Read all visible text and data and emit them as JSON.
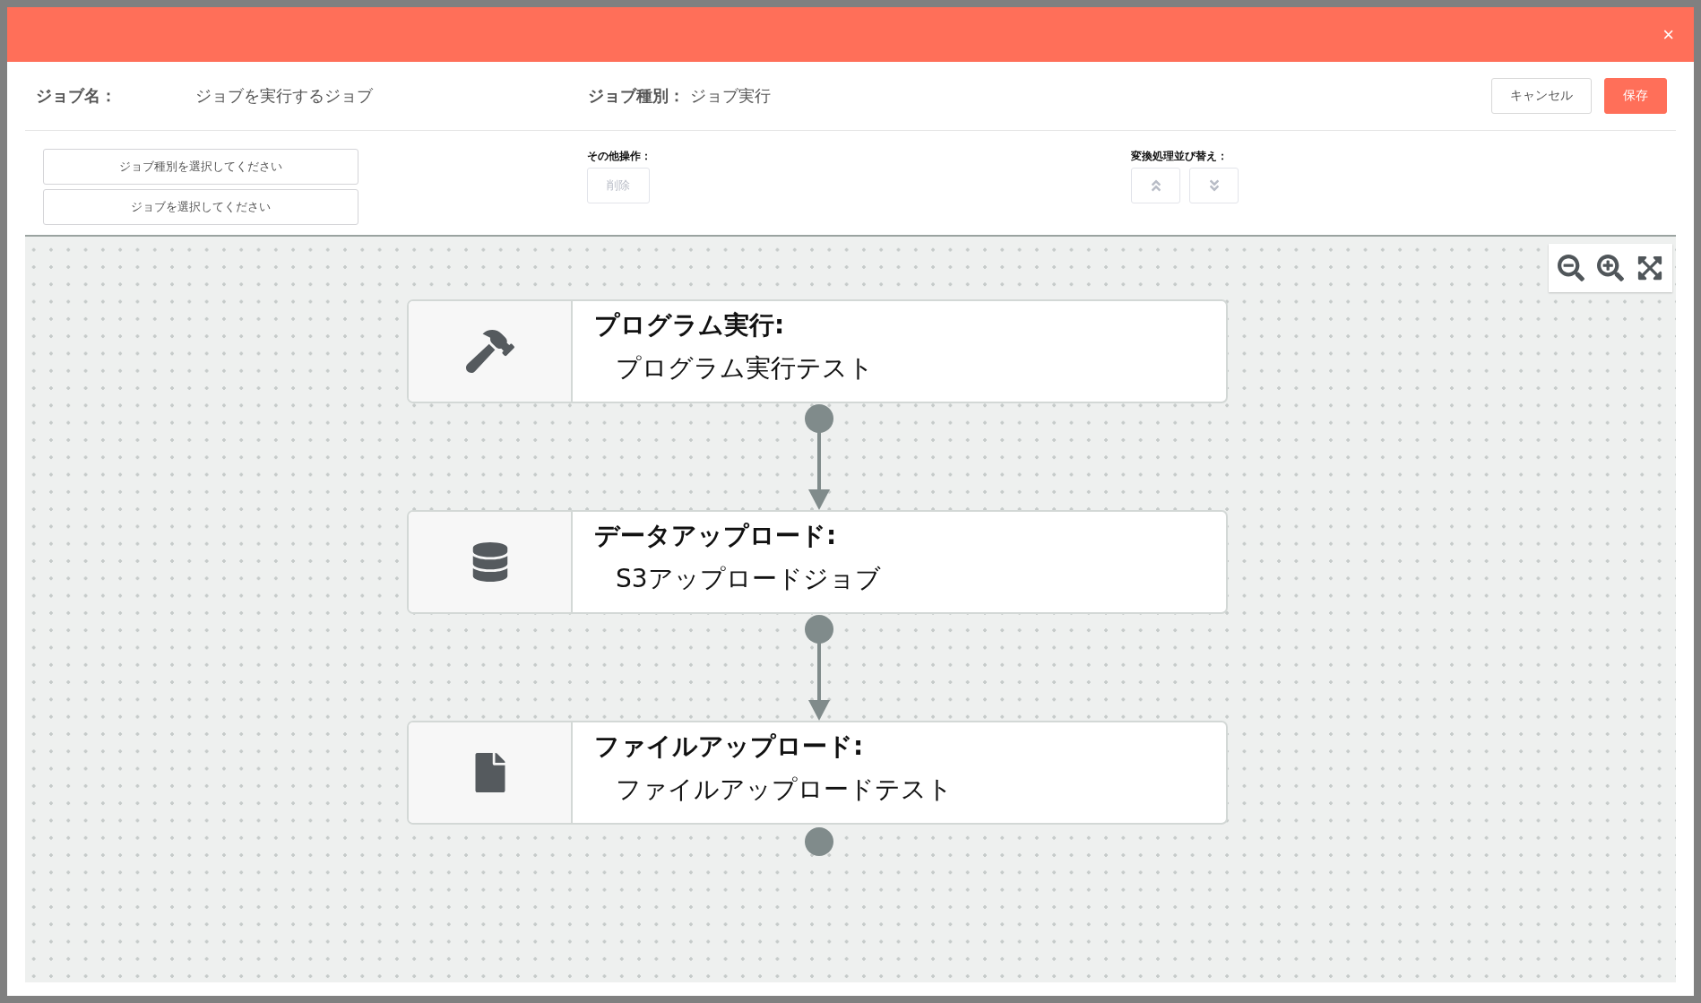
{
  "dialog": {
    "close_label": "×"
  },
  "job_info": {
    "name_label": "ジョブ名：",
    "name_value": "ジョブを実行するジョブ",
    "type_label": "ジョブ種別：",
    "type_value": "ジョブ実行"
  },
  "actions": [
    {
      "label": "キャンセル",
      "kind": "secondary"
    },
    {
      "label": "保存",
      "kind": "primary"
    }
  ],
  "selectors": [
    {
      "label": "ジョブ種別を選択してください"
    },
    {
      "label": "ジョブを選択してください"
    }
  ],
  "other_ops": {
    "label": "その他操作：",
    "buttons": [
      {
        "label": "削除",
        "disabled": true
      }
    ]
  },
  "reorder": {
    "label": "変換処理並び替え：",
    "buttons": [
      {
        "kind": "move_up",
        "disabled": true
      },
      {
        "kind": "move_down",
        "disabled": true
      }
    ]
  },
  "zoom_controls": [
    {
      "kind": "zoom_out"
    },
    {
      "kind": "zoom_in"
    },
    {
      "kind": "fit"
    }
  ],
  "nodes": [
    {
      "kind": "program",
      "title": "プログラム実行:",
      "name": "プログラム実行テスト"
    },
    {
      "kind": "upload",
      "title": "データアップロード:",
      "name": "S3アップロードジョブ"
    },
    {
      "kind": "file",
      "title": "ファイルアップロード:",
      "name": "ファイルアップロードテスト"
    }
  ]
}
